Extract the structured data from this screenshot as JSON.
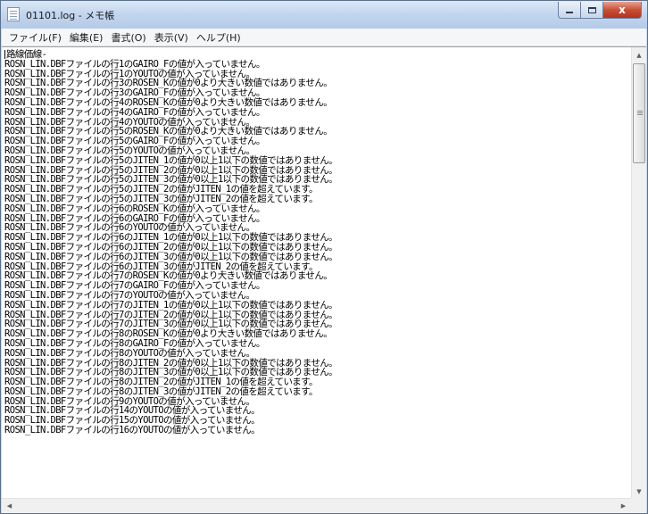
{
  "window": {
    "title": "01101.log - メモ帳"
  },
  "caption_buttons": {
    "minimize_icon": "minimize-icon",
    "maximize_icon": "maximize-icon",
    "close_label": "x"
  },
  "menu": {
    "items": [
      {
        "label": "ファイル(F)"
      },
      {
        "label": "編集(E)"
      },
      {
        "label": "書式(O)"
      },
      {
        "label": "表示(V)"
      },
      {
        "label": "ヘルプ(H)"
      }
    ]
  },
  "editor": {
    "lines": [
      "路線価線-",
      "ROSN_LIN.DBFファイルの行1のGAIRO_Fの値が入っていません。",
      "ROSN_LIN.DBFファイルの行1のYOUTOの値が入っていません。",
      "ROSN_LIN.DBFファイルの行3のROSEN_Kの値が0より大きい数値ではありません。",
      "ROSN_LIN.DBFファイルの行3のGAIRO_Fの値が入っていません。",
      "ROSN_LIN.DBFファイルの行4のROSEN_Kの値が0より大きい数値ではありません。",
      "ROSN_LIN.DBFファイルの行4のGAIRO_Fの値が入っていません。",
      "ROSN_LIN.DBFファイルの行4のYOUTOの値が入っていません。",
      "ROSN_LIN.DBFファイルの行5のROSEN_Kの値が0より大きい数値ではありません。",
      "ROSN_LIN.DBFファイルの行5のGAIRO_Fの値が入っていません。",
      "ROSN_LIN.DBFファイルの行5のYOUTOの値が入っていません。",
      "ROSN_LIN.DBFファイルの行5のJITEN_1の値が0以上1以下の数値ではありません。",
      "ROSN_LIN.DBFファイルの行5のJITEN_2の値が0以上1以下の数値ではありません。",
      "ROSN_LIN.DBFファイルの行5のJITEN_3の値が0以上1以下の数値ではありません。",
      "ROSN_LIN.DBFファイルの行5のJITEN_2の値がJITEN_1の値を超えています。",
      "ROSN_LIN.DBFファイルの行5のJITEN_3の値がJITEN_2の値を超えています。",
      "ROSN_LIN.DBFファイルの行6のROSEN_Kの値が入っていません。",
      "ROSN_LIN.DBFファイルの行6のGAIRO_Fの値が入っていません。",
      "ROSN_LIN.DBFファイルの行6のYOUTOの値が入っていません。",
      "ROSN_LIN.DBFファイルの行6のJITEN_1の値が0以上1以下の数値ではありません。",
      "ROSN_LIN.DBFファイルの行6のJITEN_2の値が0以上1以下の数値ではありません。",
      "ROSN_LIN.DBFファイルの行6のJITEN_3の値が0以上1以下の数値ではありません。",
      "ROSN_LIN.DBFファイルの行6のJITEN_3の値がJITEN_2の値を超えています。",
      "ROSN_LIN.DBFファイルの行7のROSEN_Kの値が0より大きい数値ではありません。",
      "ROSN_LIN.DBFファイルの行7のGAIRO_Fの値が入っていません。",
      "ROSN_LIN.DBFファイルの行7のYOUTOの値が入っていません。",
      "ROSN_LIN.DBFファイルの行7のJITEN_1の値が0以上1以下の数値ではありません。",
      "ROSN_LIN.DBFファイルの行7のJITEN_2の値が0以上1以下の数値ではありません。",
      "ROSN_LIN.DBFファイルの行7のJITEN_3の値が0以上1以下の数値ではありません。",
      "ROSN_LIN.DBFファイルの行8のROSEN_Kの値が0より大きい数値ではありません。",
      "ROSN_LIN.DBFファイルの行8のGAIRO_Fの値が入っていません。",
      "ROSN_LIN.DBFファイルの行8のYOUTOの値が入っていません。",
      "ROSN_LIN.DBFファイルの行8のJITEN_2の値が0以上1以下の数値ではありません。",
      "ROSN_LIN.DBFファイルの行8のJITEN_3の値が0以上1以下の数値ではありません。",
      "ROSN_LIN.DBFファイルの行8のJITEN_2の値がJITEN_1の値を超えています。",
      "ROSN_LIN.DBFファイルの行8のJITEN_3の値がJITEN_2の値を超えています。",
      "ROSN_LIN.DBFファイルの行9のYOUTOの値が入っていません。",
      "ROSN_LIN.DBFファイルの行14のYOUTOの値が入っていません。",
      "ROSN_LIN.DBFファイルの行15のYOUTOの値が入っていません。",
      "ROSN_LIN.DBFファイルの行16のYOUTOの値が入っていません。"
    ]
  }
}
